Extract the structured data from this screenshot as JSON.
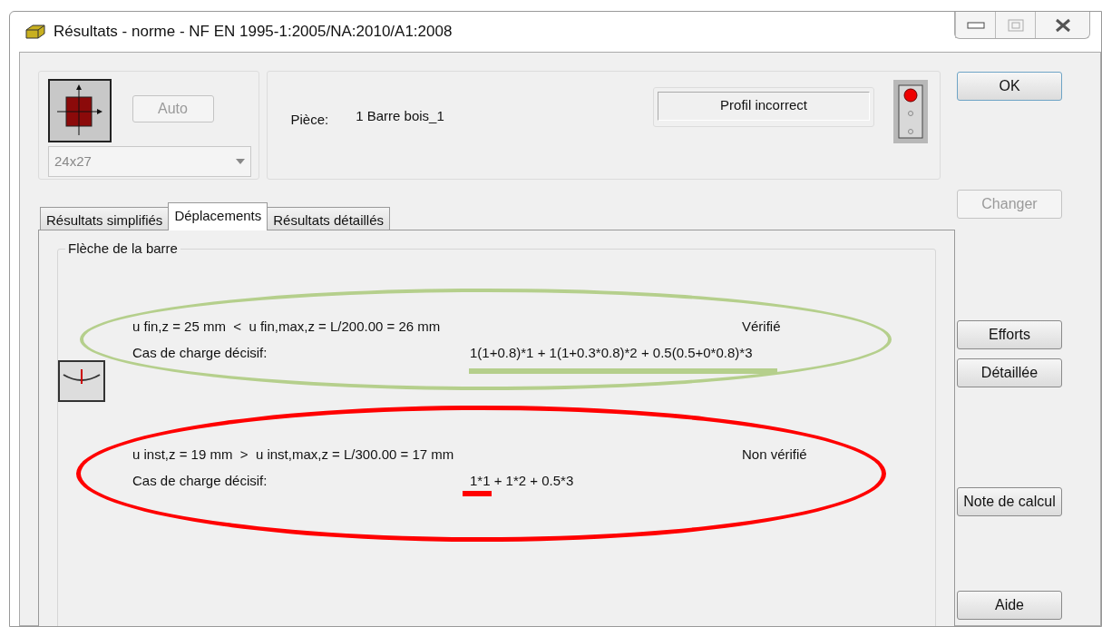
{
  "window": {
    "title": "Résultats - norme - NF EN 1995-1:2005/NA:2010/A1:2008"
  },
  "section": {
    "auto_button": {
      "label": "Auto",
      "disabled": true
    },
    "profile": {
      "value": "24x27",
      "disabled": true
    }
  },
  "piece": {
    "label": "Pièce:",
    "value": "1  Barre bois_1"
  },
  "status": {
    "message": "Profil incorrect",
    "lights": [
      {
        "on": true
      },
      {
        "on": false
      },
      {
        "on": false
      }
    ]
  },
  "tabs": [
    {
      "label": "Résultats simplifiés",
      "selected": false
    },
    {
      "label": "Déplacements",
      "selected": true
    },
    {
      "label": "Résultats détaillés",
      "selected": false
    }
  ],
  "group": {
    "title": "Flèche de la barre"
  },
  "checks": [
    {
      "condition": "u fin,z = 25 mm  <  u fin,max,z = L/200.00 = 26 mm",
      "status": "Vérifié",
      "load_label": "Cas de charge décisif:",
      "load_case": "1(1+0.8)*1 + 1(1+0.3*0.8)*2 + 0.5(0.5+0*0.8)*3",
      "color": "#b5cf8c"
    },
    {
      "condition": "u inst,z = 19 mm  >  u inst,max,z = L/300.00 = 17 mm",
      "status": "Non vérifié",
      "load_label": "Cas de charge décisif:",
      "load_case": "1*1 + 1*2 + 0.5*3",
      "color": "#ff0000"
    }
  ],
  "buttons": [
    {
      "label": "OK",
      "disabled": false
    },
    {
      "label": "Changer",
      "disabled": true
    },
    {
      "label": "Efforts",
      "disabled": false
    },
    {
      "label": "Détaillée",
      "disabled": false
    },
    {
      "label": "Note de calcul",
      "disabled": false
    },
    {
      "label": "Aide",
      "disabled": false
    }
  ]
}
